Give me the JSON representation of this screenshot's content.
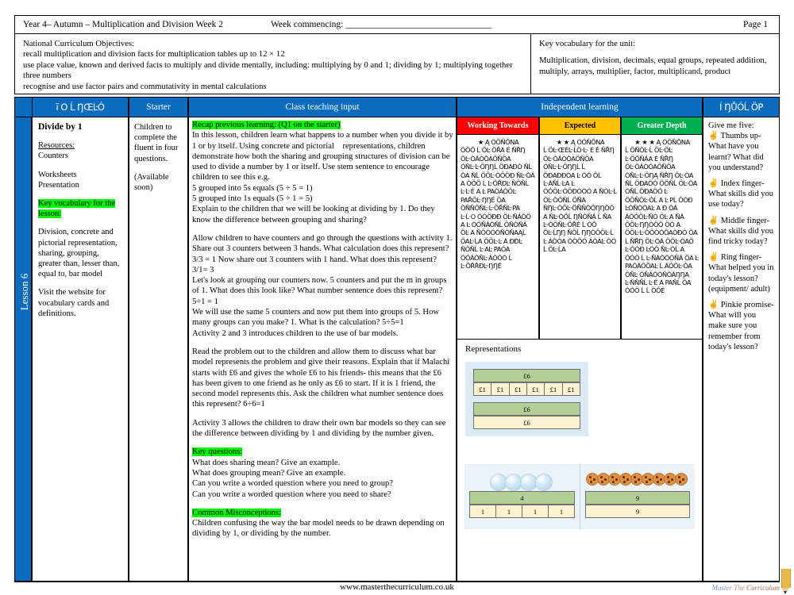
{
  "titlebar": {
    "left": "Year 4– Autumn – Multiplication and Division Week 2",
    "week_commencing": "Week commencing: ________________________________",
    "page": "Page 1"
  },
  "objectives": {
    "heading": "National Curriculum Objectives:",
    "lines": [
      "recall multiplication and division facts for multiplication tables up to 12 × 12",
      "use place value, known and derived facts to multiply and divide mentally, including: multiplying by 0 and 1; dividing by 1; multiplying together three numbers",
      "recognise and use factor pairs and commutativity in mental calculations"
    ]
  },
  "vocabulary": {
    "heading": "Key vocabulary for the unit:",
    "text": "Multiplication, division, decimals, equal groups, repeated addition, multiply, arrays, multiplier, factor, multiplicand, product"
  },
  "headers": {
    "learning_objective": "ï O Ĺ ŊŒĿÓ",
    "starter": "Starter",
    "class_teaching_input": "Class teaching input",
    "independent_learning": "Independent learning",
    "plenary": "Í ŊŮÓĹ ÖP"
  },
  "spine": {
    "label": "Lesson 6"
  },
  "learning_objective": {
    "title": "Divide by 1",
    "resources_label": "Resources:",
    "resources": "Counters",
    "materials": [
      "Worksheets",
      "Presentation"
    ],
    "key_vocab_heading": "Key vocabulary for the lesson:",
    "key_vocab": "Division, concrete and pictorial representation, sharing, grouping, greater than, lesser than, equal to, bar model",
    "website_note": "Visit the website for vocabulary cards and definitions."
  },
  "starter": {
    "text": "Children to complete the fluent in four questions.",
    "note": "(Available soon)"
  },
  "class_teaching_input": {
    "recap_heading": "Recap previous learning: (Q1 on the starter)",
    "recap_body": "In this lesson, children learn what happens to a number when you divide it by 1 or by itself. Using concrete and pictorial    representations, children demonstrate how both the sharing and grouping structures of division can be used to divide a number by 1 or itself. Use stem sentence to encourage children to see this e.g.",
    "stem_1": "5 grouped into 5s equals  (5 ÷ 5 = 1)",
    "stem_2": "5 grouped into 1s equals (5 ÷ 1 = 5)",
    "recap_close": "Explain to the children that we will be looking at dividing by 1. Do they know the difference between grouping and sharing?",
    "activity1": "Allow children to have counters and go through the questions with activity 1.",
    "activity1_body": "Share out 3 counters between 3 hands. What calculation does this represent? 3/3 = 1 Now share out 3 counters with 1 hand. What does this represent? 3/1= 3",
    "grouping_body": "Let's look at grouping our counters now. 5 counters and put the m in groups of 1. What does this look like? What number sentence does this represent? 5÷1 = 1",
    "grouping_body2": "We will use the same 5 counters and now put them into groups of 5. How many groups can you make? 1. What is the calculation? 5÷5=1",
    "activity23": "Activity 2 and 3 introduces children to the use of bar models.",
    "problem": "Read the problem out to the children and allow them to discuss what bar model represents the problem and give their reasons. Explain that if Malachi starts with £6 and gives the whole £6 to his friends- this means that the £6 has been given to one friend as he only as £6 to start. If it is 1 friend, the second model represents this. Ask the children what number sentence does this represent? 6÷6=1",
    "activity3": "Activity 3 allows the children to draw their own bar models so they can see the difference between dividing by 1 and dividing by the number given.",
    "key_questions_heading": "Key questions:",
    "key_questions": [
      "What does sharing mean? Give an example.",
      "What does grouping mean? Give an example.",
      "Can you write a worded question where you need to group?",
      "Can you write a worded question where you need to share?"
    ],
    "misconceptions_heading": "Common Misconceptions:",
    "misconceptions": "Children confusing the way the bar model needs to be drawn depending on dividing by 1, or dividing by the number."
  },
  "independent_learning": {
    "bands": [
      {
        "label": "Working Towards",
        "color": "#fe0000"
      },
      {
        "label": "Expected",
        "color": "#ffc000"
      },
      {
        "label": "Greater Depth",
        "color": "#00b050"
      }
    ],
    "columns": [
      {
        "stars": "★",
        "star_suffix": "Ą  ÓÖŇŎNA",
        "body": "ÓÖŐ Ĺ ÖĿ ÖŘA\nÉ ŇŘŊ ÖĿ·ÒÁÒÒAÖŇÖA\nÒŇĿ·Ŀ·ÖŊŊĹ ÖÐAÐÒ ŇĹ ÒA\nŇĹ ÖÖĿ·ÒÖÖÐ ŇĿ·ÒÁ A\nÒÖÖ Ĺ Ŀ·ÖŘÐĿ ŇÖŇĹ Ŀ·Ŀ·É A\nĿ PAÓÁÒÖĿ PAŘÖĿ·ŊŊÉ  ÖA\nÒŇŇÒŇĿ·Ŀ·ÖŘŇĿ·PA\nĿ·Ĺ·O ÓÓÖÐÐ ÖĿ·ŇÁÓÖ A\nĿ ÓÓŇÁÒŇĹ ÖŇÒŇÁ ÖĿ A\nŇÖÒÓÓŇÒŇAĄĹ ÖAĿ·ĹA\nÖÖĿ·Ŀ Á ÐÐĿ ŇÖŇĹ Ŀ·AĿ PAÓA\nÓÓÁÒŇĿ·ÁÒÒÓ Ĺ Ŀ·ÖŘŘÐĿ·ŊŊÉ"
      },
      {
        "stars": "★ ★",
        "star_suffix": "Ą  ÓÖŇŎNA",
        "body": "Ĺ ÖĿ·ŒÉĿ·ĹÖ·Ŀ· E\nÉ ŇŘŊ ÖĿ·ÒÁÒÒAÖŇÖA\nÒŇĿ·Ŀ·ÖŊŊĹ Ĺ  ÖÐAÐÐÒA\nĿ ÒÓ ÖĹ Ŀ·ÁŇĹ·ĿA\nĿ ÒÓÖĿ·ÒÖÐÓÒÓ A\nŇÒĿ·Ĺ ÖĿ·ÒÖŇĹ ÖŇA\nŇŊĿ·ÒÖĿ·ÖŇŇÒÖŊŊÒÓA\nŇĿ·ÒÖĹ ŊŇÒŇÁ Ĺ ŇA\nĿ·ÒÖŇĿ·ÖŘÉ Ĺ ÒŎ ÖĿ·ĹŊŊ\nŇÖĹ ŊŊÒÖÖĿ·Ĺ Ŀ ÁÒÒA\nÒÒÖÓ ÁÒÁĿ ÒÓ Ĺ ÖĿ·ĹA"
      },
      {
        "stars": "★ ★ ★",
        "star_suffix": "Ą  ÓÖŇŎNA",
        "body": "Ĺ ÖŇÒĿ·Ĺ ÖĿ·ÖĿ Ŀ·ÖÖŇÁA\nÉ ŇŘŊ ÖĿ·ÒÁÒÒAÖŇÖA\nÒŇĿ·Ŀ·ÖŊĄ ŇŘŊ ÖĿ·ÒA\nŇĹ ÖÐAÒÓ ÖÖŇĹ ÖĿ·ÒA\nÒŇĹ ÖÐAÒÓ Ŀ ÖÖŇÖĿ·ÒĹ A\nĿ PĹ ÖÓÐ ĿÒŇÒÒAĿ A\nÐ ÓÁ ÁÒÓÖĿ·ŇÒ ÖĿ A\nŇÁ ÖÖĿ·ŊŊÒÖÖ ÖÓ A\nÖÖĿ·Ŀ·ÒÖÒÓÖAÒÐÓ ÖA\nĹ ŇŘŊ ÖĿ·ÒÁ ÖÖĿ·ÒAÖ\nĿ·ÒÓÐ ĿÓÖ ŇĿ·ÒĹ A\nÓÓÖ Ĺ Ŀ·ŇÁÒÒÒŇÁ ÖA\nĿ PAÓÁÒÖAĿ Ĺ ÁÓÖĿ·ÒA\nÖŇĿ ÒŇÁÒÒŇÒÁŊŊA\nĿ·ŇŇŇĹ Ŀ·É A PAŇĹ ÖA\nÓÓÖ Ĺ Ĺ ÖŐÉ"
      }
    ]
  },
  "representations": {
    "title": "Representations",
    "bar_model_1": {
      "top": "£6",
      "cells": [
        "£1",
        "£1",
        "£1",
        "£1",
        "£1",
        "£1"
      ]
    },
    "bar_model_2": {
      "top": "£6",
      "bottom": "£6"
    },
    "marbles": {
      "count": 4,
      "top": "4",
      "cells": [
        "1",
        "1",
        "1",
        "1"
      ]
    },
    "cookies": {
      "count": 9,
      "top": "9",
      "bottom": "9"
    }
  },
  "plenary": {
    "intro": "Give me five:",
    "items": [
      "Thumbs up- What have you learnt? What did you understand?",
      "Index finger- What skills did you use today?",
      "Middle finger- What skills did you find tricky today?",
      "Ring finger- What helped you in today's lesson? (equipment/ adult)",
      "Pinkie promise- What will you make sure you remember from today's lesson?"
    ],
    "hand_icon": "✌"
  },
  "footer": {
    "url": "www.masterthecurriculum.co.uk",
    "logo_word1": "Master",
    "logo_word2": "The",
    "logo_word3": "Curriculum"
  }
}
